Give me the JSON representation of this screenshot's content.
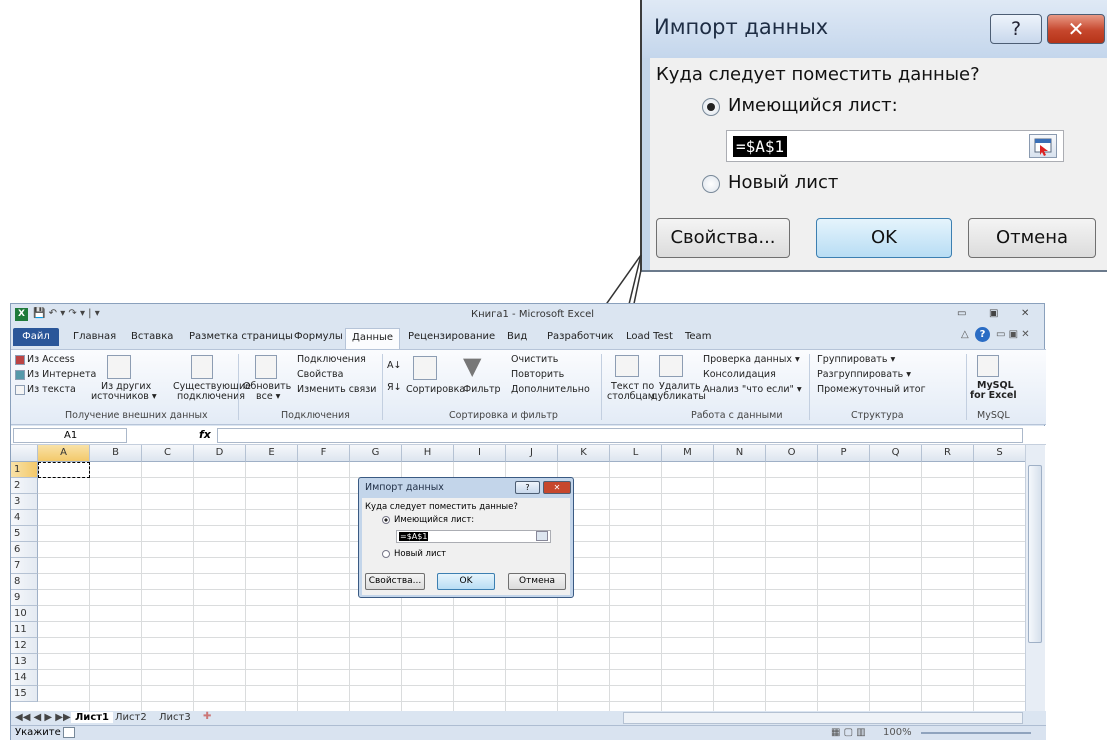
{
  "dialog": {
    "title": "Импорт данных",
    "question": "Куда следует поместить данные?",
    "option_existing": "Имеющийся лист:",
    "option_new": "Новый лист",
    "range_value": "=$A$1",
    "properties_label": "Свойства...",
    "ok_label": "OK",
    "cancel_label": "Отмена",
    "help_glyph": "?",
    "close_glyph": "✕"
  },
  "excel": {
    "title": "Книга1 - Microsoft Excel",
    "tabs": [
      "Файл",
      "Главная",
      "Вставка",
      "Разметка страницы",
      "Формулы",
      "Данные",
      "Рецензирование",
      "Вид",
      "Разработчик",
      "Load Test",
      "Team"
    ],
    "active_tab": "Данные",
    "ribbon": {
      "ext_from_access": "Из Access",
      "ext_from_web": "Из Интернета",
      "ext_from_text": "Из текста",
      "ext_other_1": "Из других",
      "ext_other_2": "источников ▾",
      "ext_existing_1": "Существующие",
      "ext_existing_2": "подключения",
      "group_external": "Получение внешних данных",
      "refresh_1": "Обновить",
      "refresh_2": "все ▾",
      "conn_connections": "Подключения",
      "conn_properties": "Свойства",
      "conn_edit_links": "Изменить связи",
      "group_connections": "Подключения",
      "sort": "Сортировка",
      "filter": "Фильтр",
      "clear": "Очистить",
      "reapply": "Повторить",
      "advanced": "Дополнительно",
      "group_sort": "Сортировка и фильтр",
      "text_cols_1": "Текст по",
      "text_cols_2": "столбцам",
      "remove_dup_1": "Удалить",
      "remove_dup_2": "дубликаты",
      "data_validation": "Проверка данных ▾",
      "consolidate": "Консолидация",
      "whatif": "Анализ \"что если\" ▾",
      "group_data_tools": "Работа с данными",
      "group_btn": "Группировать ▾",
      "ungroup_btn": "Разгруппировать ▾",
      "subtotal": "Промежуточный итог",
      "group_outline": "Структура",
      "mysql_1": "MySQL",
      "mysql_2": "for Excel",
      "group_mysql": "MySQL"
    },
    "name_box": "A1",
    "fx": "fx",
    "columns": [
      "A",
      "B",
      "C",
      "D",
      "E",
      "F",
      "G",
      "H",
      "I",
      "J",
      "K",
      "L",
      "M",
      "N",
      "O",
      "P",
      "Q",
      "R",
      "S"
    ],
    "rows": [
      "1",
      "2",
      "3",
      "4",
      "5",
      "6",
      "7",
      "8",
      "9",
      "10",
      "11",
      "12",
      "13",
      "14",
      "15"
    ],
    "sheets": [
      "Лист1",
      "Лист2",
      "Лист3"
    ],
    "status_text": "Укажите",
    "zoom": "100%"
  },
  "colors": {
    "accent": "#2a5699",
    "dialog_frame": "#c3d5ea",
    "close_red": "#c6472d"
  }
}
